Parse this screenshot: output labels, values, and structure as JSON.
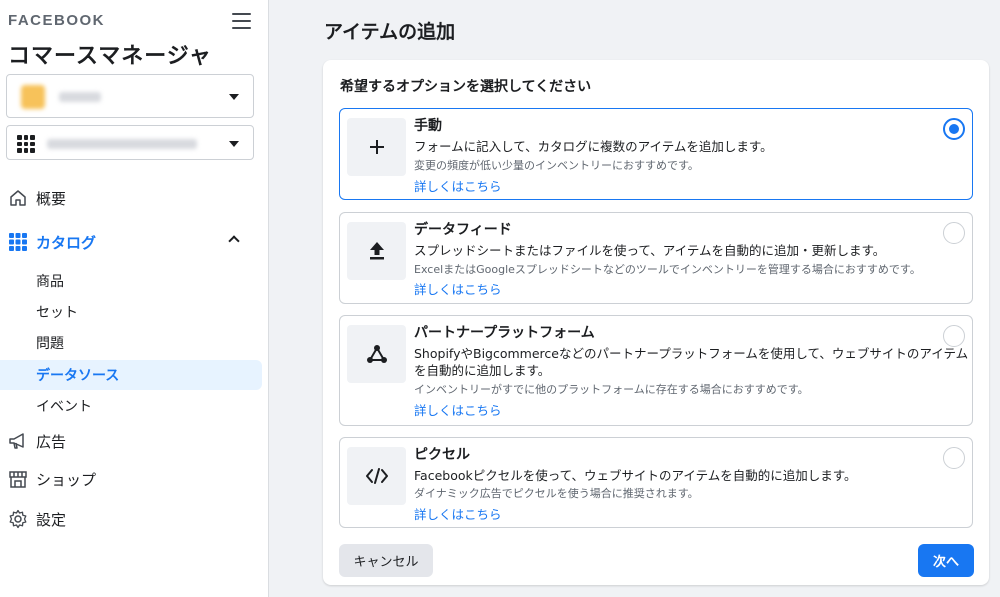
{
  "sidebar": {
    "brand": "FACEBOOK",
    "app_title": "コマースマネージャ",
    "nav": {
      "overview": "概要",
      "catalog": "カタログ",
      "catalog_sub": [
        "商品",
        "セット",
        "問題",
        "データソース",
        "イベント"
      ],
      "ads": "広告",
      "shop": "ショップ",
      "settings": "設定"
    },
    "active_sub": "データソース"
  },
  "main": {
    "page_title": "アイテムの追加",
    "card_heading": "希望するオプションを選択してください",
    "options": [
      {
        "title": "手動",
        "desc": "フォームに記入して、カタログに複数のアイテムを追加します。",
        "note": "変更の頻度が低い少量のインベントリーにおすすめです。",
        "link": "詳しくはこちら",
        "icon": "plus-icon",
        "selected": true
      },
      {
        "title": "データフィード",
        "desc": "スプレッドシートまたはファイルを使って、アイテムを自動的に追加・更新します。",
        "note": "ExcelまたはGoogleスプレッドシートなどのツールでインベントリーを管理する場合におすすめです。",
        "link": "詳しくはこちら",
        "icon": "upload-icon",
        "selected": false
      },
      {
        "title": "パートナープラットフォーム",
        "desc": "ShopifyやBigcommerceなどのパートナープラットフォームを使用して、ウェブサイトのアイテムを自動的に追加します。",
        "note": "インベントリーがすでに他のプラットフォームに存在する場合におすすめです。",
        "link": "詳しくはこちら",
        "icon": "share-nodes-icon",
        "selected": false
      },
      {
        "title": "ピクセル",
        "desc": "Facebookピクセルを使って、ウェブサイトのアイテムを自動的に追加します。",
        "note": "ダイナミック広告でピクセルを使う場合に推奨されます。",
        "link": "詳しくはこちら",
        "icon": "code-icon",
        "selected": false
      }
    ],
    "cancel_label": "キャンセル",
    "next_label": "次へ"
  },
  "colors": {
    "accent": "#1877f2",
    "background": "#f0f2f5",
    "active_bg": "#e7f3ff"
  }
}
